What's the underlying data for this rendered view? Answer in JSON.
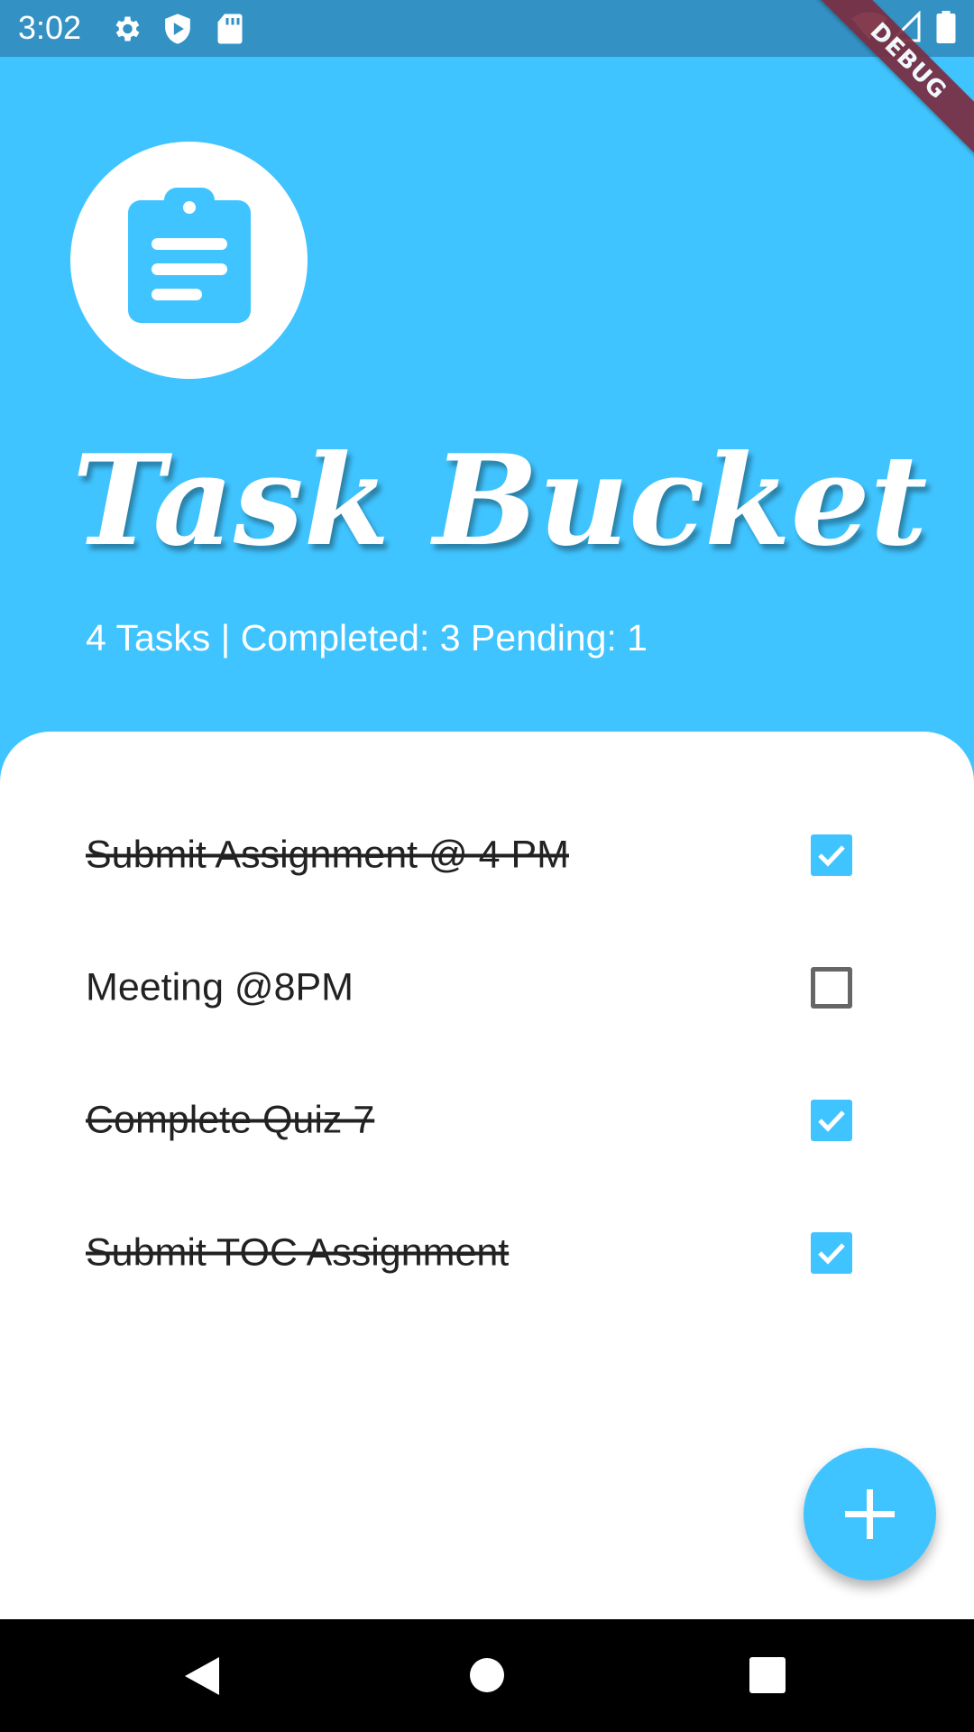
{
  "status_bar": {
    "time": "3:02",
    "icons": [
      "settings-icon",
      "play-protect-icon",
      "sd-card-icon",
      "wifi-icon",
      "signal-icon",
      "battery-icon"
    ]
  },
  "debug_banner": "DEBUG",
  "header": {
    "logo_icon": "clipboard-icon",
    "title": "Task Bucket",
    "summary": "4 Tasks | Completed: 3  Pending: 1"
  },
  "tasks": [
    {
      "text": "Submit Assignment @ 4 PM",
      "completed": true
    },
    {
      "text": "Meeting @8PM",
      "completed": false
    },
    {
      "text": "Complete Quiz 7",
      "completed": true
    },
    {
      "text": "Submit TOC  Assignment",
      "completed": true
    }
  ],
  "fab_icon": "add-icon",
  "nav_bar": {
    "icons": [
      "back-icon",
      "home-icon",
      "recents-icon"
    ]
  },
  "colors": {
    "accent": "#40C4FF",
    "status_bar": "#3391C4",
    "debug_ribbon": "#7A2D3F"
  }
}
